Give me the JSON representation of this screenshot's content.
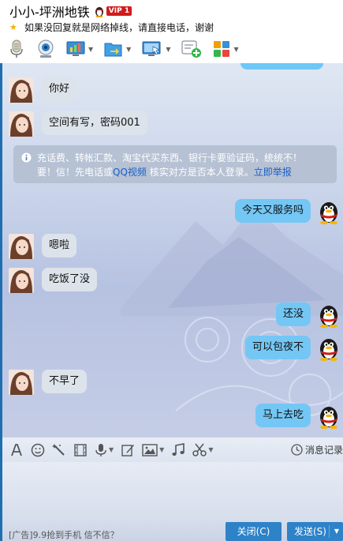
{
  "window": {
    "title": "小小-坪洲地铁",
    "vip_badge": "VIP 1",
    "signature": "如果没回复就是网络掉线，请直接电话，谢谢"
  },
  "toolbar": {
    "items": [
      {
        "icon": "microphone-icon"
      },
      {
        "icon": "camera-icon"
      },
      {
        "icon": "presentation-icon"
      },
      {
        "icon": "file-transfer-icon"
      },
      {
        "icon": "remote-desktop-icon"
      },
      {
        "icon": "add-app-icon"
      },
      {
        "icon": "apps-grid-icon"
      }
    ]
  },
  "chat": {
    "messages": [
      {
        "side": "left",
        "text": "你好"
      },
      {
        "side": "left",
        "text": "空间有写，密码001"
      },
      {
        "side": "right",
        "text": "今天又服务吗"
      },
      {
        "side": "left",
        "text": "嗯啦"
      },
      {
        "side": "left",
        "text": "吃饭了没"
      },
      {
        "side": "right",
        "text": "还没"
      },
      {
        "side": "right",
        "text": "可以包夜不"
      },
      {
        "side": "left",
        "text": "不早了"
      },
      {
        "side": "right",
        "text": "马上去吃"
      }
    ],
    "notice": {
      "line1": "充话费、转帐汇款、淘宝代买东西、银行卡要验证码，统统不！",
      "line2_a": "要！信！先电话或",
      "link1": "QQ视频",
      "line2_b": "核实对方是否本人登录。",
      "link2": "立即举报"
    }
  },
  "input_toolbar": {
    "history_label": "消息记录"
  },
  "footer": {
    "ad_text": "[广告]9.9抢到手机 信不信？",
    "close_label": "关闭(C)",
    "send_label": "发送(S)"
  },
  "colors": {
    "accent": "#2d82c8",
    "bubble_right": "#74c7f5",
    "bubble_left": "#dde3ea",
    "vip": "#d21b1b"
  }
}
